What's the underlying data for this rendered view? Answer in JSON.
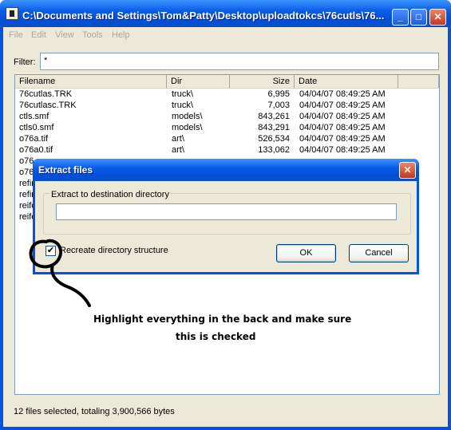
{
  "window": {
    "title": "C:\\Documents and Settings\\Tom&Patty\\Desktop\\uploadtokcs\\76cutls\\76...",
    "controls": {
      "minimize": "_",
      "maximize": "□",
      "close": "✕"
    }
  },
  "menubar": {
    "items": [
      "File",
      "Edit",
      "View",
      "Tools",
      "Help"
    ]
  },
  "filter": {
    "label": "Filter:",
    "value": "*"
  },
  "listview": {
    "columns": [
      "Filename",
      "Dir",
      "Size",
      "Date"
    ],
    "rows": [
      {
        "filename": "76cutlas.TRK",
        "dir": "truck\\",
        "size": "6,995",
        "date": "04/04/07 08:49:25 AM"
      },
      {
        "filename": "76cutlasc.TRK",
        "dir": "truck\\",
        "size": "7,003",
        "date": "04/04/07 08:49:25 AM"
      },
      {
        "filename": "ctls.smf",
        "dir": "models\\",
        "size": "843,261",
        "date": "04/04/07 08:49:25 AM"
      },
      {
        "filename": "ctls0.smf",
        "dir": "models\\",
        "size": "843,291",
        "date": "04/04/07 08:49:25 AM"
      },
      {
        "filename": "o76a.tif",
        "dir": "art\\",
        "size": "526,534",
        "date": "04/04/07 08:49:25 AM"
      },
      {
        "filename": "o76a0.tif",
        "dir": "art\\",
        "size": "133,062",
        "date": "04/04/07 08:49:25 AM"
      },
      {
        "filename": "o76",
        "dir": "",
        "size": "",
        "date": ""
      },
      {
        "filename": "o76",
        "dir": "",
        "size": "",
        "date": ""
      },
      {
        "filename": "refir",
        "dir": "",
        "size": "",
        "date": ""
      },
      {
        "filename": "refir",
        "dir": "",
        "size": "",
        "date": ""
      },
      {
        "filename": "reife",
        "dir": "",
        "size": "",
        "date": ""
      },
      {
        "filename": "reife",
        "dir": "",
        "size": "",
        "date": ""
      }
    ]
  },
  "status": {
    "text": "12 files selected, totaling 3,900,566 bytes"
  },
  "dialog": {
    "title": "Extract files",
    "close": "✕",
    "group_label": "Extract to destination directory",
    "destination_value": "",
    "checkbox_label": "Recreate directory structure",
    "checkbox_mark": "✔",
    "ok_label": "OK",
    "cancel_label": "Cancel"
  },
  "annotation": {
    "line1": "Highlight everything in the back and make sure",
    "line2": "this is checked",
    "color": "#000000"
  }
}
